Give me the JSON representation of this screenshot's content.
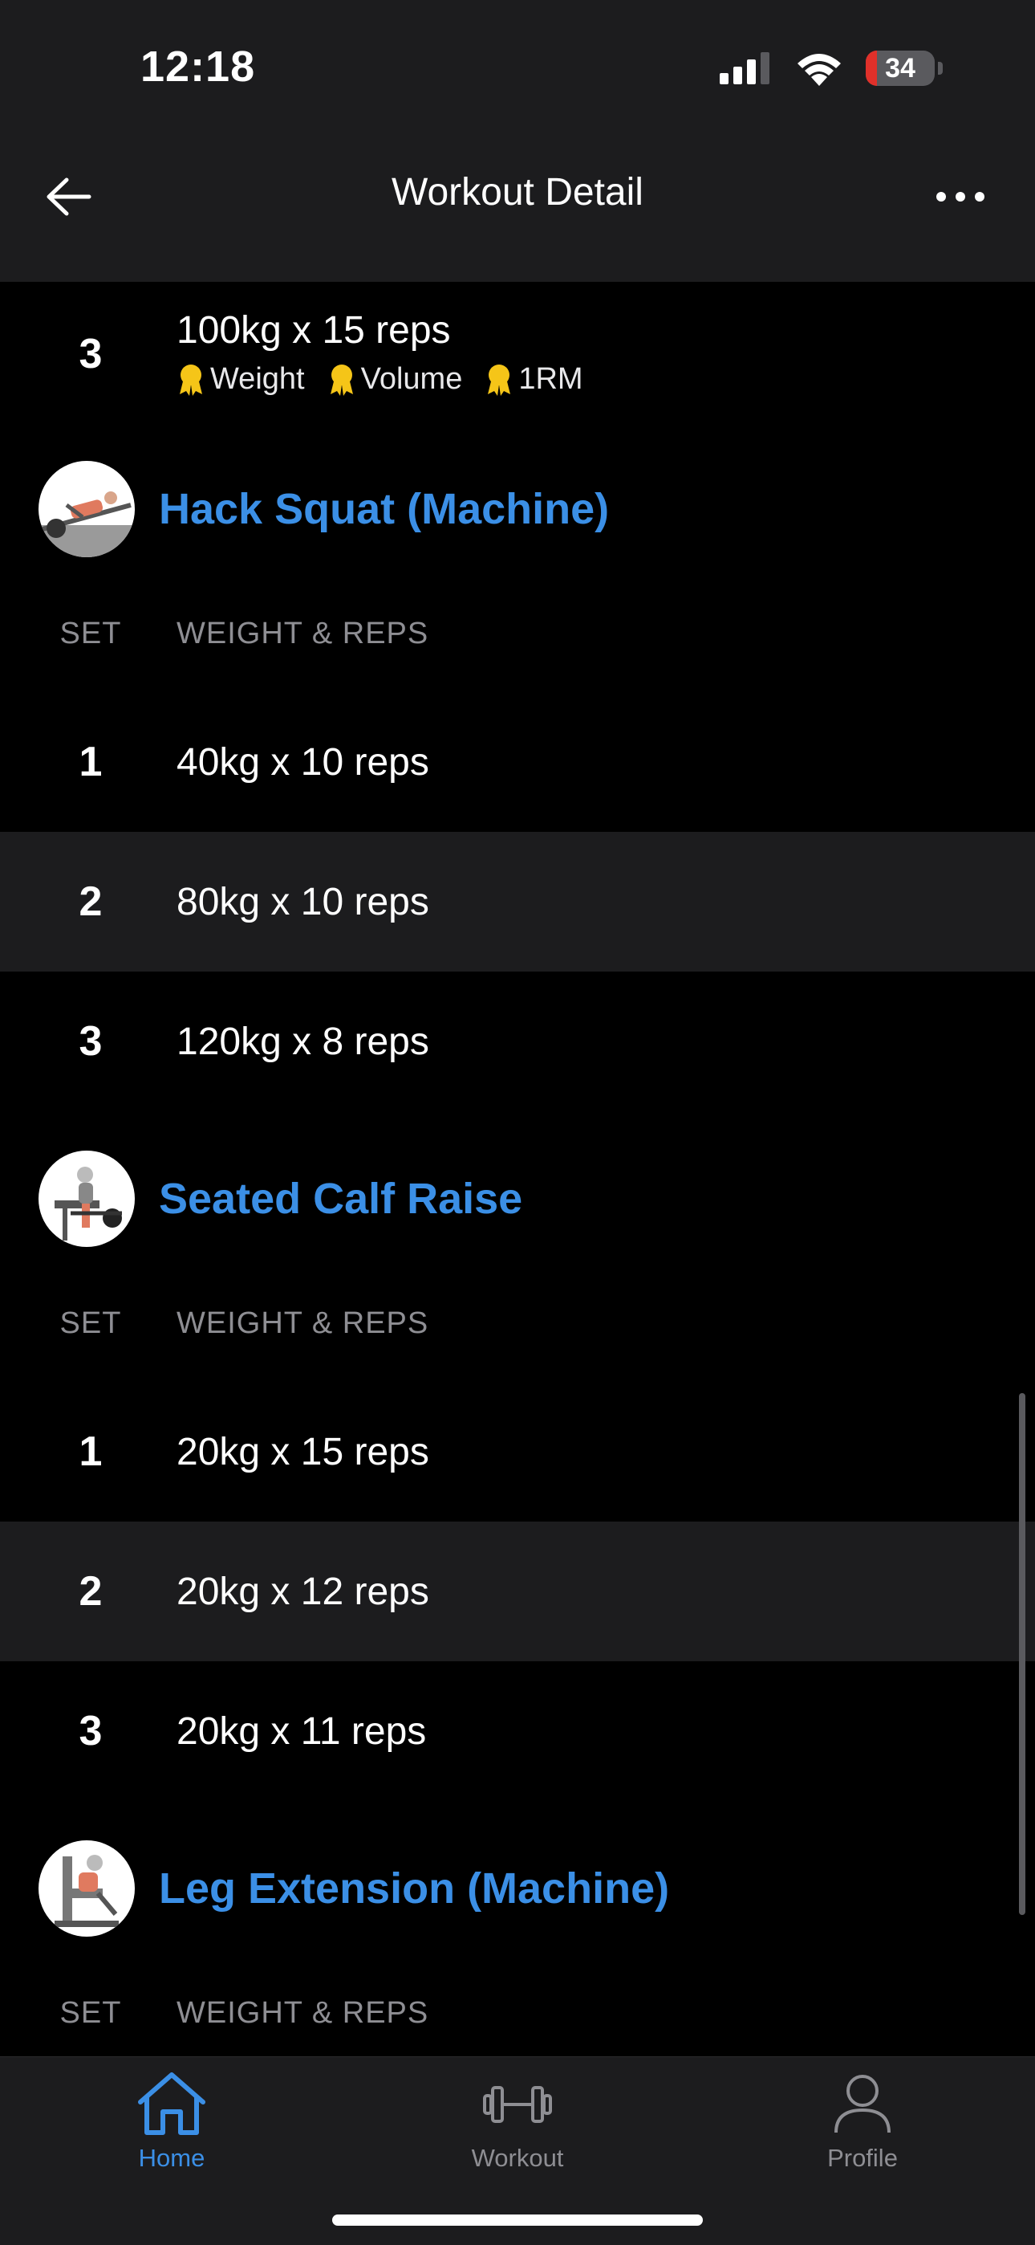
{
  "status": {
    "time": "12:18",
    "battery": "34"
  },
  "nav": {
    "title": "Workout Detail"
  },
  "top_partial_set": {
    "set": "3",
    "value": "100kg x 15 reps",
    "records": [
      "Weight",
      "Volume",
      "1RM"
    ]
  },
  "exercises": [
    {
      "name": "Hack Squat (Machine)",
      "col_set": "SET",
      "col_weight": "WEIGHT & REPS",
      "sets": [
        {
          "set": "1",
          "value": "40kg x 10 reps"
        },
        {
          "set": "2",
          "value": "80kg x 10 reps"
        },
        {
          "set": "3",
          "value": "120kg x 8 reps"
        }
      ]
    },
    {
      "name": "Seated Calf Raise",
      "col_set": "SET",
      "col_weight": "WEIGHT & REPS",
      "sets": [
        {
          "set": "1",
          "value": "20kg x 15 reps"
        },
        {
          "set": "2",
          "value": "20kg x 12 reps"
        },
        {
          "set": "3",
          "value": "20kg x 11 reps"
        }
      ]
    },
    {
      "name": "Leg Extension (Machine)",
      "col_set": "SET",
      "col_weight": "WEIGHT & REPS",
      "sets": []
    }
  ],
  "tabbar": {
    "home": "Home",
    "workout": "Workout",
    "profile": "Profile"
  },
  "colors": {
    "accent": "#3b8fe6",
    "background": "#000000",
    "surface": "#1c1c1e",
    "medal": "#f5c518"
  }
}
